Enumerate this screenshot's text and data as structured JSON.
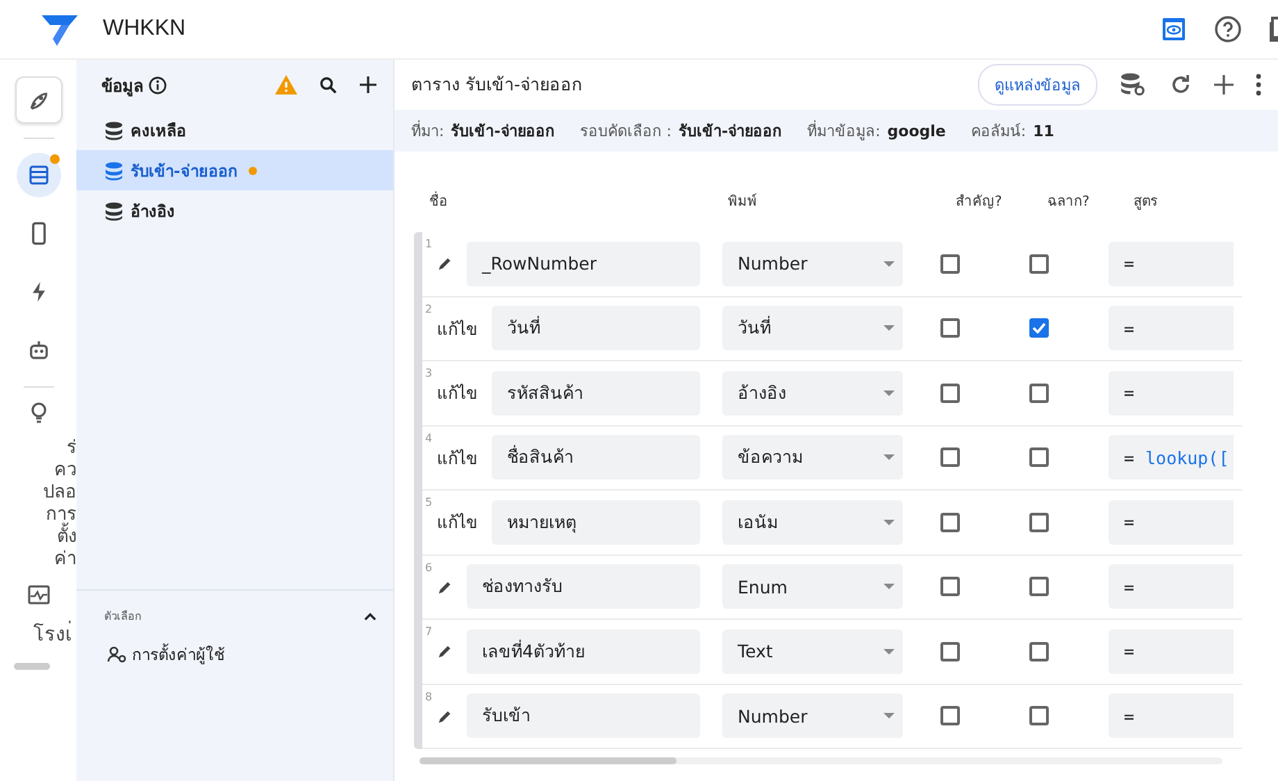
{
  "app": {
    "title": "WHKKN"
  },
  "rail": {
    "items": [
      {
        "kind": "rocket",
        "selected": false,
        "badge": false
      },
      {
        "kind": "table",
        "selected": true,
        "badge": true
      },
      {
        "kind": "phone",
        "selected": false,
        "badge": false
      },
      {
        "kind": "bolt",
        "selected": false,
        "badge": false
      },
      {
        "kind": "robot",
        "selected": false,
        "badge": false
      }
    ],
    "labels": [
      "ร่",
      "คว",
      "ปลอ",
      "การ",
      "ตั้ง",
      "ค่า"
    ],
    "bottom_label": "โรงเ่"
  },
  "sidebar": {
    "title": "ข้อมูล",
    "items": [
      {
        "label": "คงเหลือ",
        "selected": false,
        "badge": false
      },
      {
        "label": "รับเข้า-จ่ายออก",
        "selected": true,
        "badge": true
      },
      {
        "label": "อ้างอิง",
        "selected": false,
        "badge": false
      }
    ],
    "options": {
      "title": "ตัวเลือก",
      "expanded": true,
      "items": [
        "การตั้งค่าผู้ใช้"
      ]
    }
  },
  "main": {
    "title": "ตาราง รับเข้า-จ่ายออก",
    "view_source": "ดูแหล่งข้อมูล",
    "info": [
      {
        "label": "ที่มา:",
        "value": "รับเข้า-จ่ายออก"
      },
      {
        "label": "รอบคัดเลือก :",
        "value": "รับเข้า-จ่ายออก"
      },
      {
        "label": "ที่มาข้อมูล:",
        "value": "google"
      },
      {
        "label": "คอลัมน์:",
        "value": "11"
      }
    ],
    "columns": [
      "ชื่อ",
      "พิมพ์",
      "สำคัญ?",
      "ฉลาก?",
      "สูตร"
    ],
    "rows": [
      {
        "number": "1",
        "kind": "pencil",
        "name": "_RowNumber",
        "type": "Number",
        "key": false,
        "label": false,
        "formula": "="
      },
      {
        "number": "2",
        "kind": "text",
        "edit_label": "แก้ไข",
        "name": "วันที่",
        "type": "วันที่",
        "key": false,
        "label": true,
        "formula": "="
      },
      {
        "number": "3",
        "kind": "text",
        "edit_label": "แก้ไข",
        "name": "รหัสสินค้า",
        "type": "อ้างอิง",
        "key": false,
        "label": false,
        "formula": "="
      },
      {
        "number": "4",
        "kind": "text",
        "edit_label": "แก้ไข",
        "name": "ชื่อสินค้า",
        "type": "ข้อความ",
        "key": false,
        "label": false,
        "formula": "=",
        "formula_code": "lookup(["
      },
      {
        "number": "5",
        "kind": "text",
        "edit_label": "แก้ไข",
        "name": "หมายเหตุ",
        "type": "เอนัม",
        "key": false,
        "label": false,
        "formula": "="
      },
      {
        "number": "6",
        "kind": "pencil",
        "name": "ช่องทางรับ",
        "type": "Enum",
        "key": false,
        "label": false,
        "formula": "="
      },
      {
        "number": "7",
        "kind": "pencil",
        "name": "เลขที่4ตัวท้าย",
        "type": "Text",
        "key": false,
        "label": false,
        "formula": "="
      },
      {
        "number": "8",
        "kind": "pencil",
        "name": "รับเข้า",
        "type": "Number",
        "key": false,
        "label": false,
        "formula": "="
      }
    ]
  }
}
